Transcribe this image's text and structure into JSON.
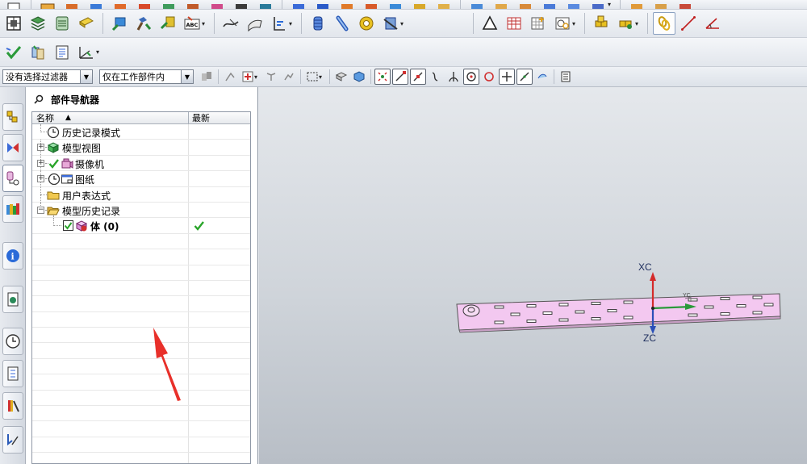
{
  "filters": {
    "selection_filter": "没有选择过滤器",
    "scope_filter": "仅在工作部件内"
  },
  "navigator": {
    "title": "部件导航器",
    "columns": {
      "name": "名称",
      "latest": "最新"
    },
    "nodes": [
      {
        "label": "历史记录模式",
        "icon": "history-mode-icon"
      },
      {
        "label": "模型视图",
        "icon": "model-views-icon"
      },
      {
        "label": "摄像机",
        "icon": "camera-icon"
      },
      {
        "label": "图纸",
        "icon": "drawing-icon"
      },
      {
        "label": "用户表达式",
        "icon": "folder-icon"
      },
      {
        "label": "模型历史记录",
        "icon": "folder-open-icon"
      },
      {
        "label": "体 (0)",
        "icon": "body-icon"
      }
    ]
  },
  "graphics": {
    "axis_x_label": "XC",
    "axis_z_label": "ZC",
    "axis_y_label": "YC"
  },
  "colors": {
    "body_fill": "#f3c8f0",
    "axis_x": "#d42a2a",
    "axis_y": "#2a9a3a",
    "axis_z": "#2a4fb8",
    "annotation_arrow": "#e8302a",
    "check_green": "#2aa52a"
  }
}
